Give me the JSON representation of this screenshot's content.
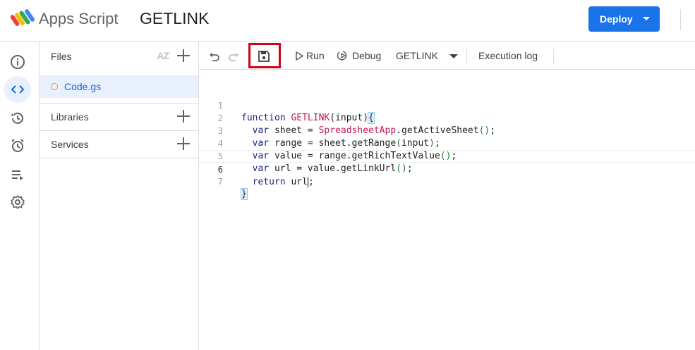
{
  "app": {
    "name": "Apps Script",
    "project_title": "GETLINK"
  },
  "header": {
    "deploy_label": "Deploy"
  },
  "rail": {
    "items": [
      {
        "name": "Overview",
        "icon": "info-icon"
      },
      {
        "name": "Editor",
        "icon": "code-icon",
        "active": true
      },
      {
        "name": "Project History",
        "icon": "history-icon"
      },
      {
        "name": "Triggers",
        "icon": "alarm-icon"
      },
      {
        "name": "Executions",
        "icon": "executions-icon"
      },
      {
        "name": "Project Settings",
        "icon": "gear-icon"
      }
    ]
  },
  "files_panel": {
    "files_label": "Files",
    "sort_label": "AZ",
    "files": [
      {
        "name": "Code.gs"
      }
    ],
    "libraries_label": "Libraries",
    "services_label": "Services"
  },
  "toolbar": {
    "run_label": "Run",
    "debug_label": "Debug",
    "function_select": "GETLINK",
    "execution_log_label": "Execution log"
  },
  "editor": {
    "lines": [
      {
        "n": "1",
        "text": "function GETLINK(input){"
      },
      {
        "n": "2",
        "text": "  var sheet = SpreadsheetApp.getActiveSheet();"
      },
      {
        "n": "3",
        "text": "  var range = sheet.getRange(input);"
      },
      {
        "n": "4",
        "text": "  var value = range.getRichTextValue();"
      },
      {
        "n": "5",
        "text": "  var url = value.getLinkUrl();"
      },
      {
        "n": "6",
        "text": "  return url;"
      },
      {
        "n": "7",
        "text": "}"
      }
    ]
  },
  "colors": {
    "accent": "#1a73e8",
    "highlight": "#d0021b",
    "active_bg": "#e8f0fe"
  }
}
